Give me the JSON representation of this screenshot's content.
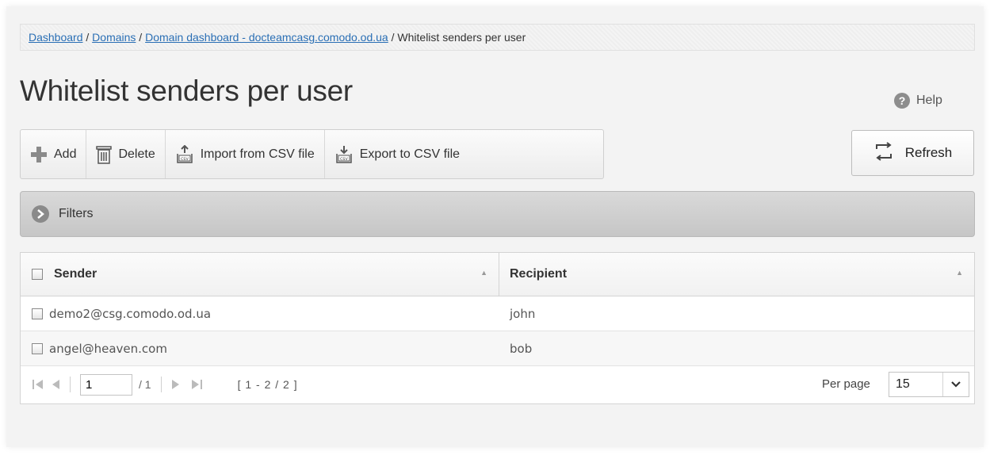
{
  "breadcrumb": {
    "items": [
      "Dashboard",
      "Domains",
      "Domain dashboard - docteamcasg.comodo.od.ua"
    ],
    "current": "Whitelist senders per user",
    "separator": " / "
  },
  "page": {
    "title": "Whitelist senders per user"
  },
  "help": {
    "label": "Help",
    "icon": "question-icon",
    "glyph": "?"
  },
  "toolbar": {
    "add": "Add",
    "delete": "Delete",
    "import": "Import from CSV file",
    "export": "Export to CSV file"
  },
  "refresh": {
    "label": "Refresh"
  },
  "filters": {
    "label": "Filters"
  },
  "grid": {
    "columns": [
      "Sender",
      "Recipient"
    ],
    "rows": [
      {
        "sender": "demo2@csg.comodo.od.ua",
        "recipient": "john"
      },
      {
        "sender": "angel@heaven.com",
        "recipient": "bob"
      }
    ]
  },
  "pager": {
    "page": "1",
    "total": "/ 1",
    "range": "[ 1 - 2 / 2 ]",
    "per_page_label": "Per page",
    "per_page_value": "15"
  },
  "colors": {
    "link": "#2a6fb5",
    "add_icon": "#8a8a8a",
    "filters_bar": "#c6c6c6"
  }
}
